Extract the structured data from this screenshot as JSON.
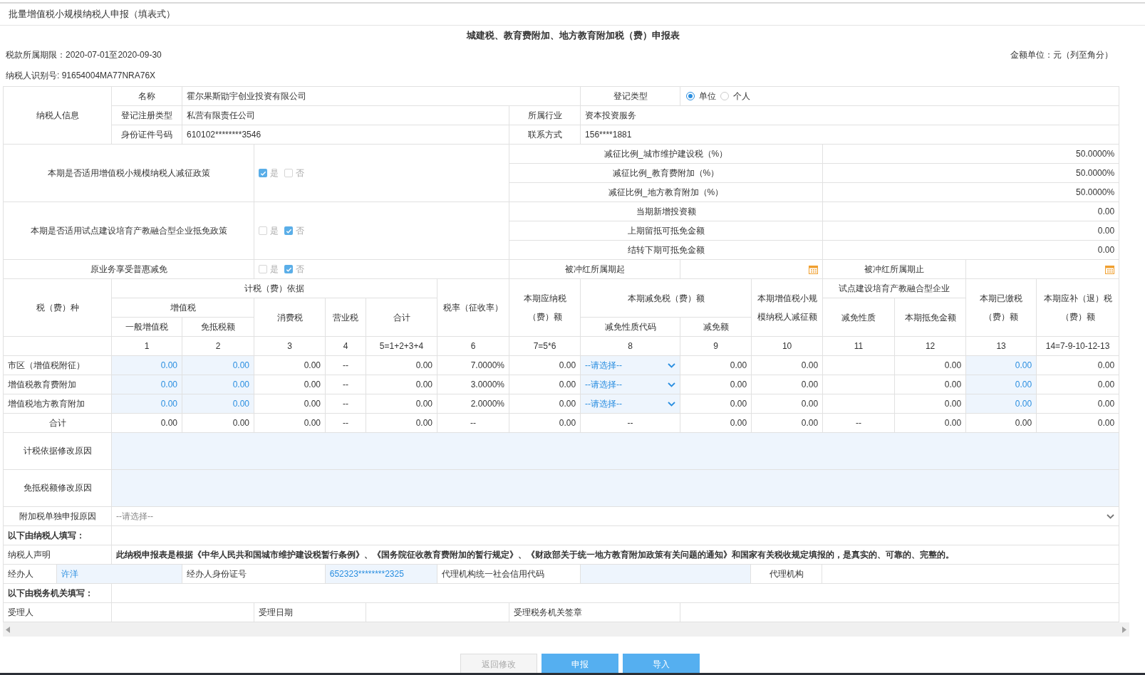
{
  "page_title": "批量增值税小规模纳税人申报（填表式）",
  "form": {
    "title": "城建税、教育费附加、地方教育附加税（费）申报表",
    "period": "税款所属期限：2020-07-01至2020-09-30",
    "amount_unit": "金额单位：元（列至角分）",
    "taxpayer_id": "纳税人识别号: 91654004MA77NRA76X"
  },
  "taxpayer_info": {
    "section_label": "纳税人信息",
    "name_label": "名称",
    "name": "霍尔果斯勖宇创业投资有限公司",
    "reg_kind_label": "登记类型",
    "reg_kind_options": [
      {
        "label": "单位",
        "selected": true
      },
      {
        "label": "个人",
        "selected": false
      }
    ],
    "reg_type_label": "登记注册类型",
    "reg_type": "私营有限责任公司",
    "industry_label": "所属行业",
    "industry": "资本投资服务",
    "id_label": "身份证件号码",
    "id": "610102********3546",
    "contact_label": "联系方式",
    "contact": "156****1881"
  },
  "policies": [
    {
      "question": "本期是否适用增值税小规模纳税人减征政策",
      "options": [
        {
          "label": "是",
          "checked": true
        },
        {
          "label": "否",
          "checked": false
        }
      ],
      "items": [
        {
          "label": "减征比例_城市维护建设税（%）",
          "value": "50.0000%"
        },
        {
          "label": "减征比例_教育费附加（%）",
          "value": "50.0000%"
        },
        {
          "label": "减征比例_地方教育附加（%）",
          "value": "50.0000%"
        }
      ]
    },
    {
      "question": "本期是否适用试点建设培育产教融合型企业抵免政策",
      "options": [
        {
          "label": "是",
          "checked": false
        },
        {
          "label": "否",
          "checked": true
        }
      ],
      "items": [
        {
          "label": "当期新增投资额",
          "value": "0.00"
        },
        {
          "label": "上期留抵可抵免金额",
          "value": "0.00"
        },
        {
          "label": "结转下期可抵免金额",
          "value": "0.00"
        }
      ]
    }
  ],
  "preferential": {
    "question": "原业务享受普惠减免",
    "options": [
      {
        "label": "是",
        "checked": false
      },
      {
        "label": "否",
        "checked": true
      }
    ],
    "start_label": "被冲红所属期起",
    "end_label": "被冲红所属期止"
  },
  "tax_table": {
    "headers": {
      "tax_type": "税（费）种",
      "basis": "计税（费）依据",
      "vat": "增值税",
      "general_vat": "一般增值税",
      "exempt_vat": "免抵税额",
      "consumption": "消费税",
      "business": "营业税",
      "basis_total": "合计",
      "rate": "税率（征收率）",
      "payable": "本期应纳税（费）额",
      "relief": "本期减免税（费）额",
      "relief_code": "减免性质代码",
      "relief_amount": "减免额",
      "small_scale": "本期增值税小规模纳税人减征额",
      "pilot": "试点建设培育产教融合型企业",
      "pilot_nature": "减免性质",
      "pilot_credit": "本期抵免金额",
      "paid": "本期已缴税（费）额",
      "due": "本期应补（退）税（费）额"
    },
    "column_numbers": [
      "1",
      "2",
      "3",
      "4",
      "5=1+2+3+4",
      "6",
      "7=5*6",
      "8",
      "9",
      "10",
      "11",
      "12",
      "13",
      "14=7-9-10-12-13"
    ],
    "rows": [
      {
        "name": "市区（增值税附征）",
        "kind": "item",
        "cells": [
          {
            "kind": "input",
            "value": "0.00"
          },
          {
            "kind": "input",
            "value": "0.00"
          },
          {
            "kind": "text",
            "value": "0.00"
          },
          {
            "kind": "na",
            "value": "--"
          },
          {
            "kind": "text",
            "value": "0.00"
          },
          {
            "kind": "text",
            "value": "7.0000%"
          },
          {
            "kind": "text",
            "value": "0.00"
          },
          {
            "kind": "select",
            "value": "--请选择--"
          },
          {
            "kind": "text",
            "value": "0.00"
          },
          {
            "kind": "text",
            "value": "0.00"
          },
          {
            "kind": "empty"
          },
          {
            "kind": "text",
            "value": "0.00"
          },
          {
            "kind": "input",
            "value": "0.00"
          },
          {
            "kind": "text",
            "value": "0.00"
          }
        ]
      },
      {
        "name": "增值税教育费附加",
        "kind": "item",
        "cells": [
          {
            "kind": "input",
            "value": "0.00"
          },
          {
            "kind": "input",
            "value": "0.00"
          },
          {
            "kind": "text",
            "value": "0.00"
          },
          {
            "kind": "na",
            "value": "--"
          },
          {
            "kind": "text",
            "value": "0.00"
          },
          {
            "kind": "text",
            "value": "3.0000%"
          },
          {
            "kind": "text",
            "value": "0.00"
          },
          {
            "kind": "select",
            "value": "--请选择--"
          },
          {
            "kind": "text",
            "value": "0.00"
          },
          {
            "kind": "text",
            "value": "0.00"
          },
          {
            "kind": "empty"
          },
          {
            "kind": "text",
            "value": "0.00"
          },
          {
            "kind": "input",
            "value": "0.00"
          },
          {
            "kind": "text",
            "value": "0.00"
          }
        ]
      },
      {
        "name": "增值税地方教育附加",
        "kind": "item",
        "cells": [
          {
            "kind": "input",
            "value": "0.00"
          },
          {
            "kind": "input",
            "value": "0.00"
          },
          {
            "kind": "text",
            "value": "0.00"
          },
          {
            "kind": "na",
            "value": "--"
          },
          {
            "kind": "text",
            "value": "0.00"
          },
          {
            "kind": "text",
            "value": "2.0000%"
          },
          {
            "kind": "text",
            "value": "0.00"
          },
          {
            "kind": "select",
            "value": "--请选择--"
          },
          {
            "kind": "text",
            "value": "0.00"
          },
          {
            "kind": "text",
            "value": "0.00"
          },
          {
            "kind": "empty"
          },
          {
            "kind": "text",
            "value": "0.00"
          },
          {
            "kind": "input",
            "value": "0.00"
          },
          {
            "kind": "text",
            "value": "0.00"
          }
        ]
      },
      {
        "name": "合计",
        "kind": "total",
        "cells": [
          {
            "kind": "text",
            "value": "0.00"
          },
          {
            "kind": "text",
            "value": "0.00"
          },
          {
            "kind": "text",
            "value": "0.00"
          },
          {
            "kind": "na",
            "value": "--"
          },
          {
            "kind": "text",
            "value": "0.00"
          },
          {
            "kind": "na",
            "value": "--"
          },
          {
            "kind": "text",
            "value": "0.00"
          },
          {
            "kind": "na",
            "value": "--"
          },
          {
            "kind": "text",
            "value": "0.00"
          },
          {
            "kind": "text",
            "value": "0.00"
          },
          {
            "kind": "na",
            "value": "--"
          },
          {
            "kind": "text",
            "value": "0.00"
          },
          {
            "kind": "text",
            "value": "0.00"
          },
          {
            "kind": "text",
            "value": "0.00"
          }
        ]
      }
    ]
  },
  "reasons": [
    {
      "label": "计税依据修改原因"
    },
    {
      "label": "免抵税额修改原因"
    }
  ],
  "separate_reason": {
    "label": "附加税单独申报原因",
    "placeholder": "--请选择--"
  },
  "taxpayer_section": "以下由纳税人填写：",
  "declaration": {
    "label": "纳税人声明",
    "text": "此纳税申报表是根据《中华人民共和国城市维护建设税暂行条例》、《国务院征收教育费附加的暂行规定》、《财政部关于统一地方教育附加政策有关问题的通知》和国家有关税收规定填报的，是真实的、可靠的、完整的。"
  },
  "agent_row": [
    {
      "kind": "label",
      "text": "经办人"
    },
    {
      "kind": "input",
      "text": "许洋"
    },
    {
      "kind": "label",
      "text": "经办人身份证号"
    },
    {
      "kind": "input",
      "text": "652323********2325"
    },
    {
      "kind": "label",
      "text": "代理机构统一社会信用代码"
    },
    {
      "kind": "input"
    },
    {
      "kind": "label",
      "text": "代理机构"
    },
    {
      "kind": "blank"
    }
  ],
  "tax_office_section": "以下由税务机关填写：",
  "acceptance_row": [
    {
      "kind": "label",
      "text": "受理人"
    },
    {
      "kind": "blank"
    },
    {
      "kind": "label",
      "text": "受理日期"
    },
    {
      "kind": "blank"
    },
    {
      "kind": "label",
      "text": "受理税务机关签章"
    },
    {
      "kind": "blank"
    }
  ],
  "buttons": [
    {
      "label": "返回修改",
      "disabled": true
    },
    {
      "label": "申报",
      "disabled": false
    },
    {
      "label": "导入",
      "disabled": false
    }
  ]
}
